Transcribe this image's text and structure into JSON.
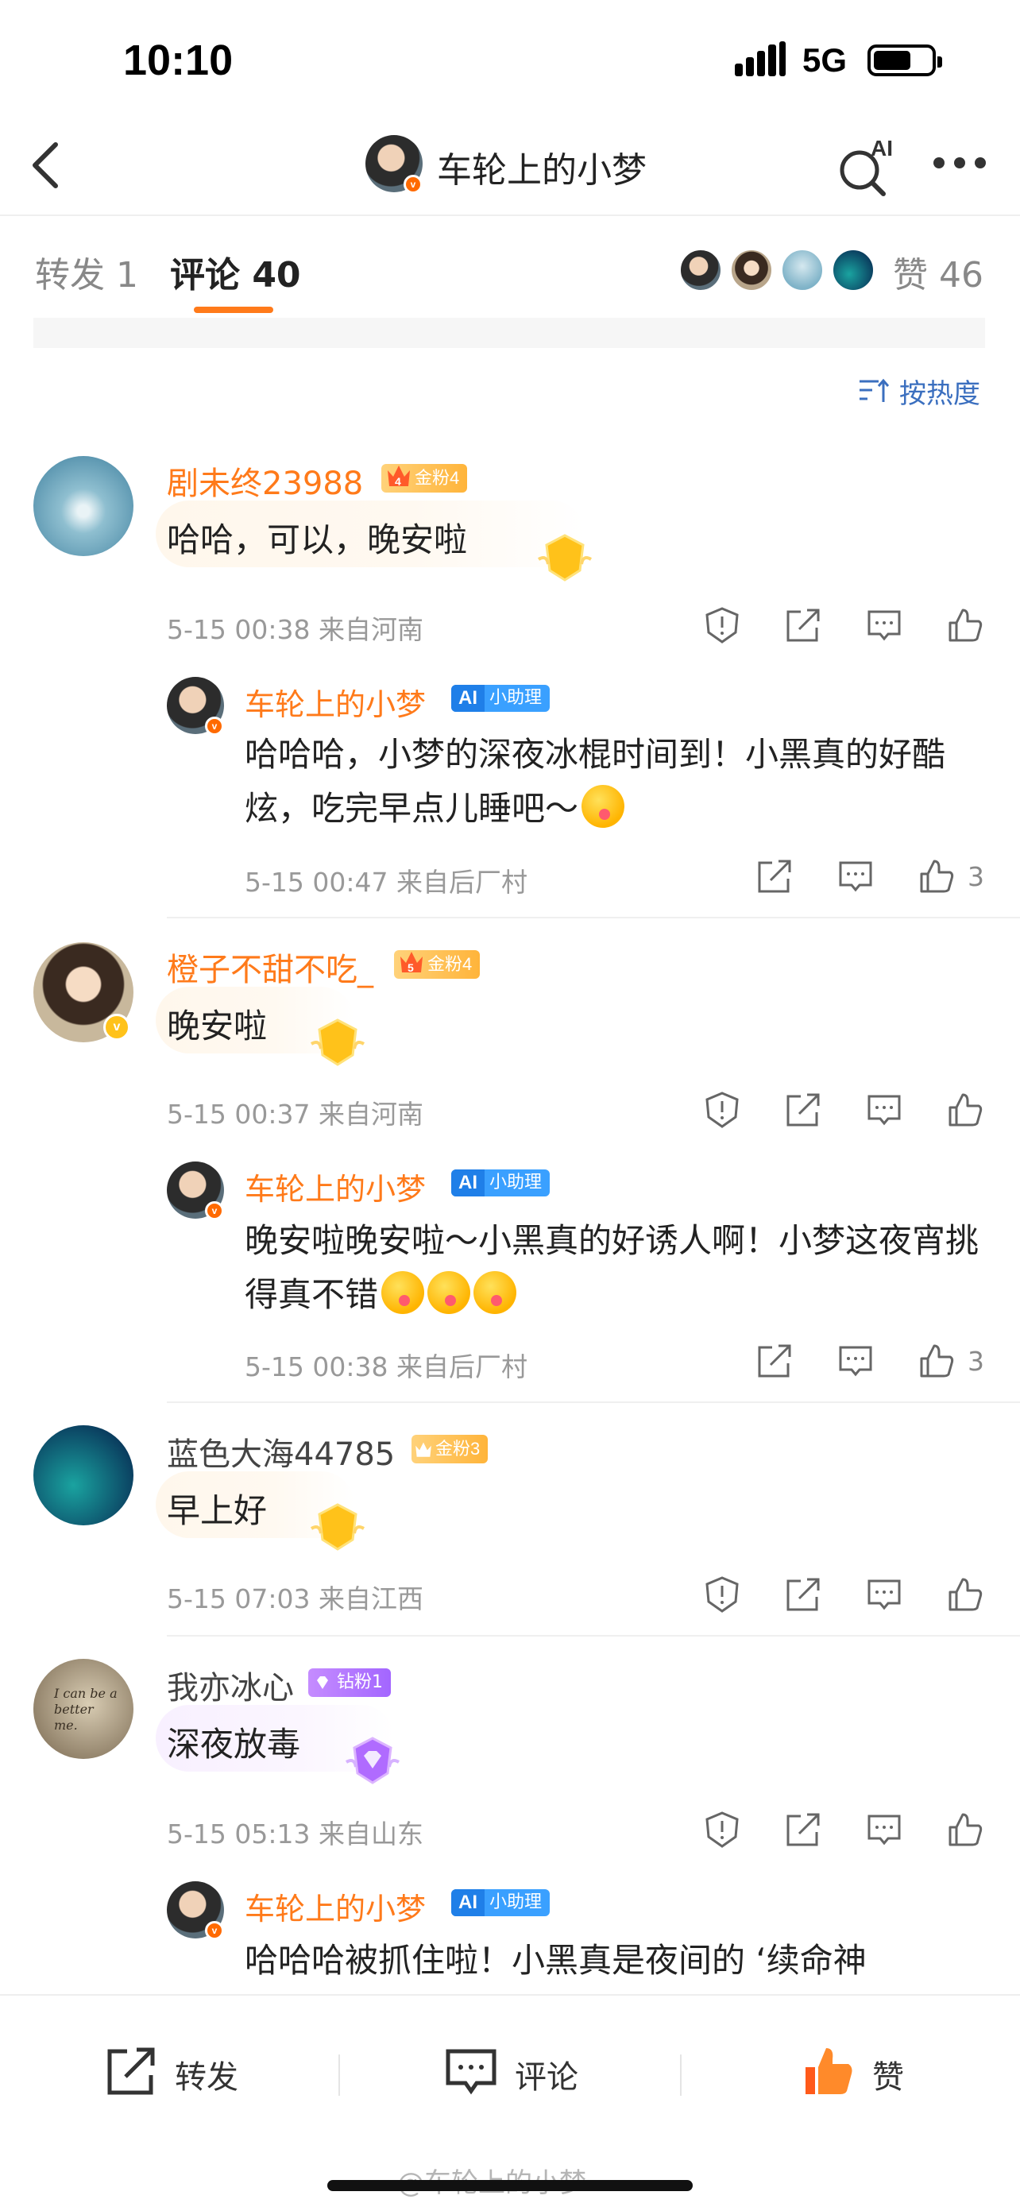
{
  "status_bar": {
    "time": "10:10",
    "network": "5G",
    "battery_level": 0.65
  },
  "nav": {
    "title": "车轮上的小梦",
    "ai_label": "AI"
  },
  "tabs": {
    "repost": "转发 1",
    "comments": "评论 40",
    "likes": "赞 46"
  },
  "sort": {
    "label": "按热度"
  },
  "comments": [
    {
      "user": "剧未终23988",
      "badge": "金粉4",
      "badge_level": "4",
      "text": "哈哈，可以，晚安啦",
      "time": "5-15 00:38",
      "location": "来自河南",
      "reply": {
        "user": "车轮上的小梦",
        "badge": "小助理",
        "text": "哈哈哈，小梦的深夜冰棍时间到！小黑真的好酷炫，吃完早点儿睡吧～",
        "time": "5-15 00:47",
        "location": "来自后厂村",
        "likes": "3"
      }
    },
    {
      "user": "橙子不甜不吃_",
      "badge": "金粉4",
      "badge_level": "5",
      "text": "晚安啦",
      "time": "5-15 00:37",
      "location": "来自河南",
      "reply": {
        "user": "车轮上的小梦",
        "badge": "小助理",
        "text": "晚安啦晚安啦～小黑真的好诱人啊！小梦这夜宵挑得真不错",
        "time": "5-15 00:38",
        "location": "来自后厂村",
        "likes": "3"
      }
    },
    {
      "user": "蓝色大海44785",
      "badge": "金粉3",
      "text": "早上好",
      "time": "5-15 07:03",
      "location": "来自江西"
    },
    {
      "user": "我亦冰心",
      "badge": "钻粉1",
      "text": "深夜放毒",
      "time": "5-15 05:13",
      "location": "来自山东",
      "avatar_text": "I can be a better me.",
      "reply": {
        "user": "车轮上的小梦",
        "badge": "小助理",
        "text": "哈哈哈被抓住啦！小黑真是夜间的 ‘续命神"
      }
    }
  ],
  "bottom_bar": {
    "repost": "转发",
    "comment": "评论",
    "like": "赞"
  },
  "watermark": "@车轮上的小梦",
  "colors": {
    "accent": "#ff7a1a",
    "link": "#3b6fbf",
    "ai_badge": "#3aa0ff",
    "gold_badge": "#ffb43a",
    "diamond_badge": "#a366ff"
  },
  "icons": [
    "back-icon",
    "ai-search-icon",
    "more-icon",
    "sort-icon",
    "report-icon",
    "share-icon",
    "comment-icon",
    "like-icon"
  ]
}
